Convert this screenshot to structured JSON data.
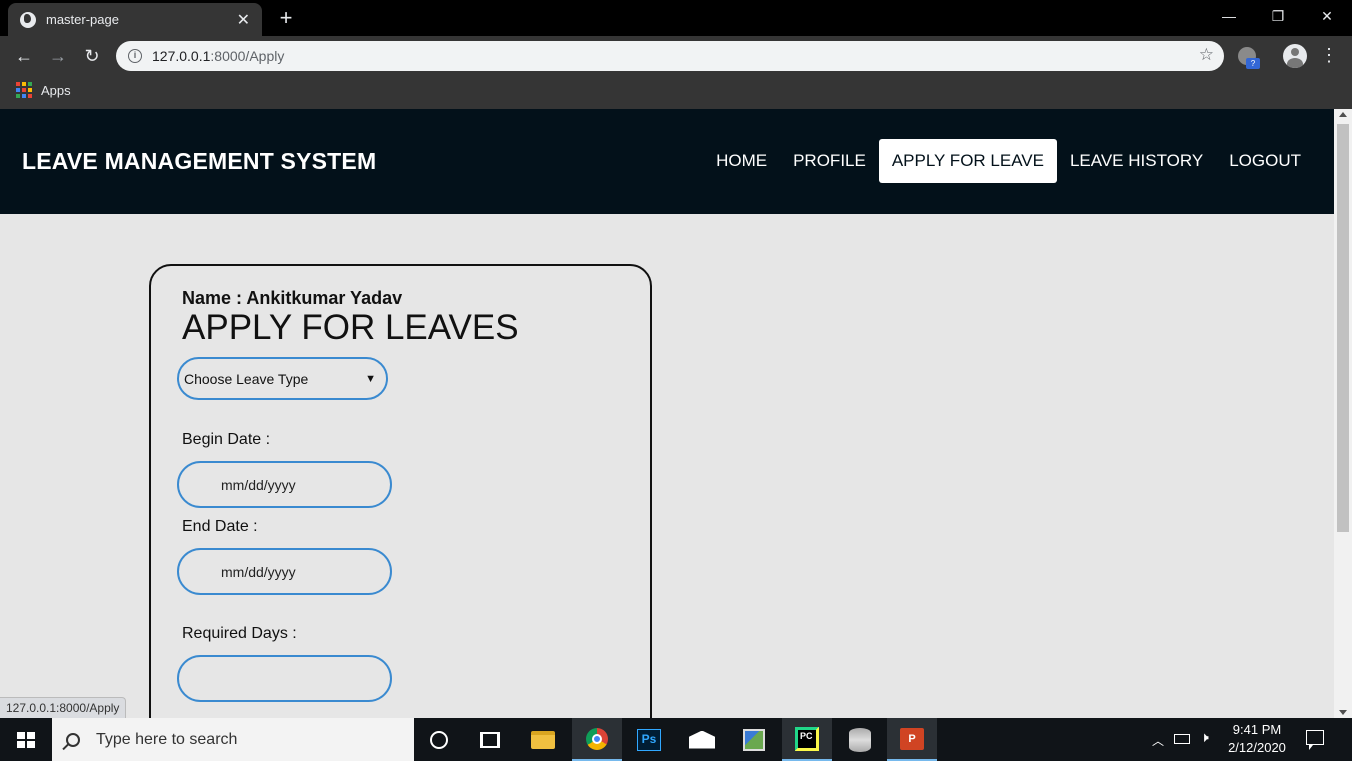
{
  "browser": {
    "tab_title": "master-page",
    "tab_close": "✕",
    "new_tab": "+",
    "window_controls": {
      "minimize": "—",
      "restore": "❐",
      "close": "✕"
    },
    "url_host": "127.0.0.1",
    "url_path": ":8000/Apply",
    "bookmarks": {
      "apps_label": "Apps"
    },
    "ext_badge": "?",
    "status_url": "127.0.0.1:8000/Apply"
  },
  "navbar": {
    "brand": "LEAVE MANAGEMENT SYSTEM",
    "links": [
      {
        "label": "HOME"
      },
      {
        "label": "PROFILE"
      },
      {
        "label": "APPLY FOR LEAVE",
        "active": true
      },
      {
        "label": "LEAVE HISTORY"
      },
      {
        "label": "LOGOUT"
      }
    ]
  },
  "form": {
    "name_line": "Name : Ankitkumar Yadav",
    "title": "APPLY FOR LEAVES",
    "leave_type": {
      "selected": "Choose Leave Type"
    },
    "begin_date": {
      "label": "Begin Date :",
      "placeholder": "mm/dd/yyyy"
    },
    "end_date": {
      "label": "End Date :",
      "placeholder": "mm/dd/yyyy"
    },
    "required_days": {
      "label": "Required Days :",
      "value": ""
    }
  },
  "taskbar": {
    "search_placeholder": "Type here to search",
    "ps_label": "Ps",
    "pc_label": "PC",
    "ppt_label": "P",
    "time": "9:41 PM",
    "date": "2/12/2020"
  },
  "colors": {
    "navbar_bg": "#03111a",
    "page_bg": "#e6e6e6",
    "input_border": "#3a8ad0"
  }
}
